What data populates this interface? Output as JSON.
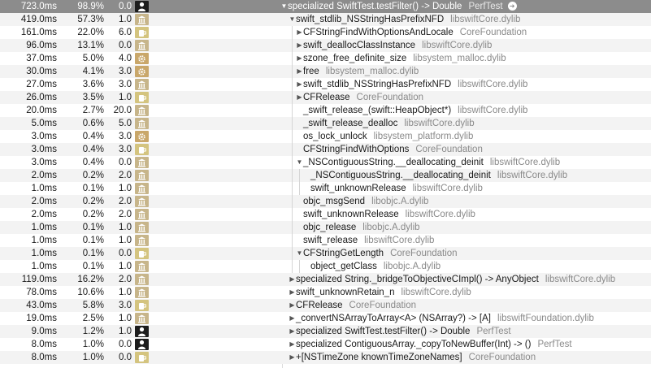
{
  "header_row": {
    "time": "723.0ms",
    "percent": "98.9%",
    "self": "0.0",
    "kind": "user",
    "symbol": "specialized SwiftTest.testFilter() -> Double",
    "library": "PerfTest",
    "disclosure": "expanded",
    "focus_icon": "focus-arrow-icon"
  },
  "rows": [
    {
      "time": "419.0ms",
      "percent": "57.3%",
      "self": "1.0",
      "kind": "lib",
      "depth": 0,
      "disclosure": "expanded",
      "symbol": "swift_stdlib_NSStringHasPrefixNFD",
      "library": "libswiftCore.dylib"
    },
    {
      "time": "161.0ms",
      "percent": "22.0%",
      "self": "6.0",
      "kind": "lib-alt",
      "depth": 1,
      "disclosure": "collapsed",
      "symbol": "CFStringFindWithOptionsAndLocale",
      "library": "CoreFoundation"
    },
    {
      "time": "96.0ms",
      "percent": "13.1%",
      "self": "0.0",
      "kind": "lib",
      "depth": 1,
      "disclosure": "collapsed",
      "symbol": "swift_deallocClassInstance",
      "library": "libswiftCore.dylib"
    },
    {
      "time": "37.0ms",
      "percent": "5.0%",
      "self": "4.0",
      "kind": "sys",
      "depth": 1,
      "disclosure": "collapsed",
      "symbol": "szone_free_definite_size",
      "library": "libsystem_malloc.dylib"
    },
    {
      "time": "30.0ms",
      "percent": "4.1%",
      "self": "3.0",
      "kind": "sys",
      "depth": 1,
      "disclosure": "collapsed",
      "symbol": "free",
      "library": "libsystem_malloc.dylib"
    },
    {
      "time": "27.0ms",
      "percent": "3.6%",
      "self": "3.0",
      "kind": "lib",
      "depth": 1,
      "disclosure": "collapsed",
      "symbol": "swift_stdlib_NSStringHasPrefixNFD",
      "library": "libswiftCore.dylib"
    },
    {
      "time": "26.0ms",
      "percent": "3.5%",
      "self": "1.0",
      "kind": "lib-alt",
      "depth": 1,
      "disclosure": "collapsed",
      "symbol": "CFRelease",
      "library": "CoreFoundation"
    },
    {
      "time": "20.0ms",
      "percent": "2.7%",
      "self": "20.0",
      "kind": "lib",
      "depth": 1,
      "disclosure": "none",
      "symbol": "_swift_release_(swift::HeapObject*)",
      "library": "libswiftCore.dylib"
    },
    {
      "time": "5.0ms",
      "percent": "0.6%",
      "self": "5.0",
      "kind": "lib",
      "depth": 1,
      "disclosure": "none",
      "symbol": "_swift_release_dealloc",
      "library": "libswiftCore.dylib"
    },
    {
      "time": "3.0ms",
      "percent": "0.4%",
      "self": "3.0",
      "kind": "sys",
      "depth": 1,
      "disclosure": "none",
      "symbol": "os_lock_unlock",
      "library": "libsystem_platform.dylib"
    },
    {
      "time": "3.0ms",
      "percent": "0.4%",
      "self": "3.0",
      "kind": "lib-alt",
      "depth": 1,
      "disclosure": "none",
      "symbol": "CFStringFindWithOptions",
      "library": "CoreFoundation"
    },
    {
      "time": "3.0ms",
      "percent": "0.4%",
      "self": "0.0",
      "kind": "lib",
      "depth": 1,
      "disclosure": "expanded",
      "symbol": "_NSContiguousString.__deallocating_deinit",
      "library": "libswiftCore.dylib"
    },
    {
      "time": "2.0ms",
      "percent": "0.2%",
      "self": "2.0",
      "kind": "lib",
      "depth": 2,
      "disclosure": "none",
      "symbol": "_NSContiguousString.__deallocating_deinit",
      "library": "libswiftCore.dylib"
    },
    {
      "time": "1.0ms",
      "percent": "0.1%",
      "self": "1.0",
      "kind": "lib",
      "depth": 2,
      "disclosure": "none",
      "symbol": "swift_unknownRelease",
      "library": "libswiftCore.dylib"
    },
    {
      "time": "2.0ms",
      "percent": "0.2%",
      "self": "2.0",
      "kind": "lib",
      "depth": 1,
      "disclosure": "none",
      "symbol": "objc_msgSend",
      "library": "libobjc.A.dylib"
    },
    {
      "time": "2.0ms",
      "percent": "0.2%",
      "self": "2.0",
      "kind": "lib",
      "depth": 1,
      "disclosure": "none",
      "symbol": "swift_unknownRelease",
      "library": "libswiftCore.dylib"
    },
    {
      "time": "1.0ms",
      "percent": "0.1%",
      "self": "1.0",
      "kind": "lib",
      "depth": 1,
      "disclosure": "none",
      "symbol": "objc_release",
      "library": "libobjc.A.dylib"
    },
    {
      "time": "1.0ms",
      "percent": "0.1%",
      "self": "1.0",
      "kind": "lib",
      "depth": 1,
      "disclosure": "none",
      "symbol": "swift_release",
      "library": "libswiftCore.dylib"
    },
    {
      "time": "1.0ms",
      "percent": "0.1%",
      "self": "0.0",
      "kind": "lib-alt",
      "depth": 1,
      "disclosure": "expanded",
      "symbol": "CFStringGetLength",
      "library": "CoreFoundation"
    },
    {
      "time": "1.0ms",
      "percent": "0.1%",
      "self": "1.0",
      "kind": "lib",
      "depth": 2,
      "disclosure": "none",
      "symbol": "object_getClass",
      "library": "libobjc.A.dylib"
    },
    {
      "time": "119.0ms",
      "percent": "16.2%",
      "self": "2.0",
      "kind": "lib",
      "depth": 0,
      "disclosure": "collapsed",
      "symbol": "specialized String._bridgeToObjectiveCImpl() -> AnyObject",
      "library": "libswiftCore.dylib"
    },
    {
      "time": "78.0ms",
      "percent": "10.6%",
      "self": "1.0",
      "kind": "lib",
      "depth": 0,
      "disclosure": "collapsed",
      "symbol": "swift_unknownRetain_n",
      "library": "libswiftCore.dylib"
    },
    {
      "time": "43.0ms",
      "percent": "5.8%",
      "self": "3.0",
      "kind": "lib-alt",
      "depth": 0,
      "disclosure": "collapsed",
      "symbol": "CFRelease",
      "library": "CoreFoundation"
    },
    {
      "time": "19.0ms",
      "percent": "2.5%",
      "self": "1.0",
      "kind": "lib",
      "depth": 0,
      "disclosure": "collapsed",
      "symbol": "_convertNSArrayToArray<A> (NSArray?) -> [A]",
      "library": "libswiftFoundation.dylib"
    },
    {
      "time": "9.0ms",
      "percent": "1.2%",
      "self": "1.0",
      "kind": "user",
      "depth": 0,
      "disclosure": "collapsed",
      "symbol": "specialized SwiftTest.testFilter() -> Double",
      "library": "PerfTest"
    },
    {
      "time": "8.0ms",
      "percent": "1.0%",
      "self": "0.0",
      "kind": "user",
      "depth": 0,
      "disclosure": "collapsed",
      "symbol": "specialized ContiguousArray._copyToNewBuffer(Int) -> ()",
      "library": "PerfTest"
    },
    {
      "time": "8.0ms",
      "percent": "1.0%",
      "self": "0.0",
      "kind": "lib-alt",
      "depth": 0,
      "disclosure": "collapsed",
      "symbol": "+[NSTimeZone knownTimeZoneNames]",
      "library": "CoreFoundation"
    }
  ],
  "icon_names": {
    "user": "user-silhouette-icon",
    "lib": "building-columns-icon",
    "lib-alt": "mug-icon",
    "sys": "gear-icon"
  }
}
